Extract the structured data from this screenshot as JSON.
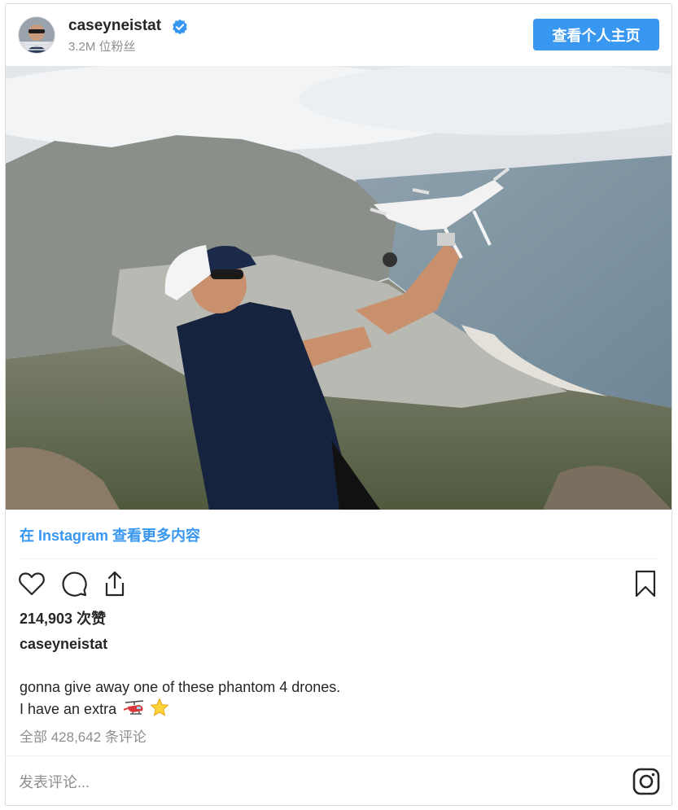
{
  "header": {
    "username": "caseyneistat",
    "followers": "3.2M 位粉丝",
    "view_profile_label": "查看个人主页",
    "verified_icon": "verified-badge-icon",
    "accent_color": "#3897f0"
  },
  "post": {
    "view_more_label": "在 Instagram 查看更多内容",
    "likes": "214,903 次赞",
    "caption_username": "caseyneistat",
    "caption_line1": "gonna give away one of these phantom 4 drones.",
    "caption_line2": "I have an extra",
    "caption_emojis": [
      "helicopter-icon",
      "star-icon"
    ],
    "all_comments": "全部 428,642 条评论"
  },
  "actions": {
    "icons": [
      "heart-icon",
      "comment-icon",
      "share-icon",
      "bookmark-icon"
    ]
  },
  "comment_box": {
    "placeholder": "发表评论..."
  }
}
